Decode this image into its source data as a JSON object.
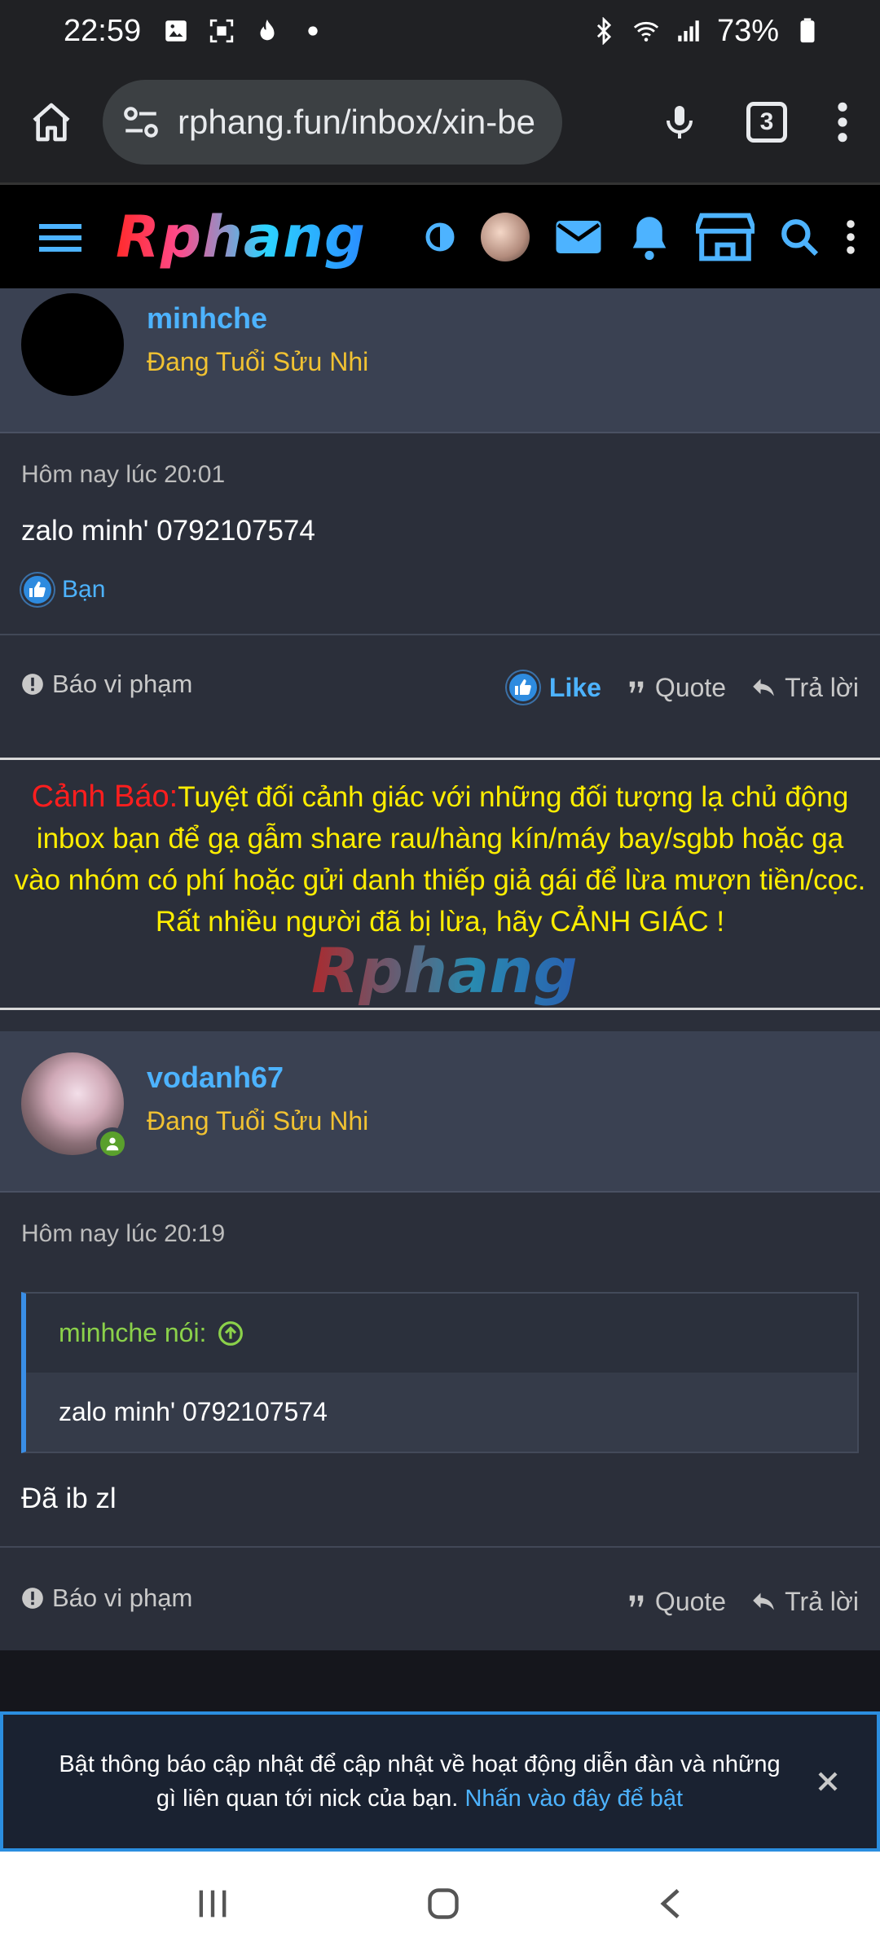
{
  "status_bar": {
    "time": "22:59",
    "battery": "73%"
  },
  "browser": {
    "url": "rphang.fun/inbox/xin-be",
    "tab_count": "3"
  },
  "site": {
    "logo_text": "Rphang"
  },
  "post1": {
    "username": "minhche",
    "user_title": "Đang Tuổi Sửu Nhi",
    "time": "Hôm nay lúc 20:01",
    "message": "zalo minh' 0792107574",
    "reaction_label": "Bạn",
    "report": "Báo vi phạm",
    "like": "Like",
    "quote": "Quote",
    "reply": "Trả lời"
  },
  "warning": {
    "label": "Cảnh Báo:",
    "text": "Tuyệt đối cảnh giác với những đối tượng lạ chủ động inbox bạn để gạ gẫm share rau/hàng kín/máy bay/sgbb hoặc gạ vào nhóm có phí hoặc gửi danh thiếp giả gái để lừa mượn tiền/cọc.",
    "text2": "Rất nhiều người đã bị lừa, hãy CẢNH GIÁC !",
    "watermark": "Rphang"
  },
  "post2": {
    "username": "vodanh67",
    "user_title": "Đang Tuổi Sửu Nhi",
    "time": "Hôm nay lúc 20:19",
    "quote_author": "minhche nói:",
    "quote_text": "zalo minh' 0792107574",
    "message": "Đã ib zl",
    "report": "Báo vi phạm",
    "quote": "Quote",
    "reply": "Trả lời"
  },
  "notification": {
    "text": "Bật thông báo cập nhật để cập nhật về hoạt động diễn đàn và những gì liên quan tới nick của bạn.",
    "link": "Nhấn vào đây để bật"
  },
  "colors": {
    "accent": "#4db3ff",
    "warning_yellow": "#ffee00",
    "warning_red": "#ff1e1e",
    "user_title": "#f1c232",
    "quote_author": "#8bd14a"
  }
}
